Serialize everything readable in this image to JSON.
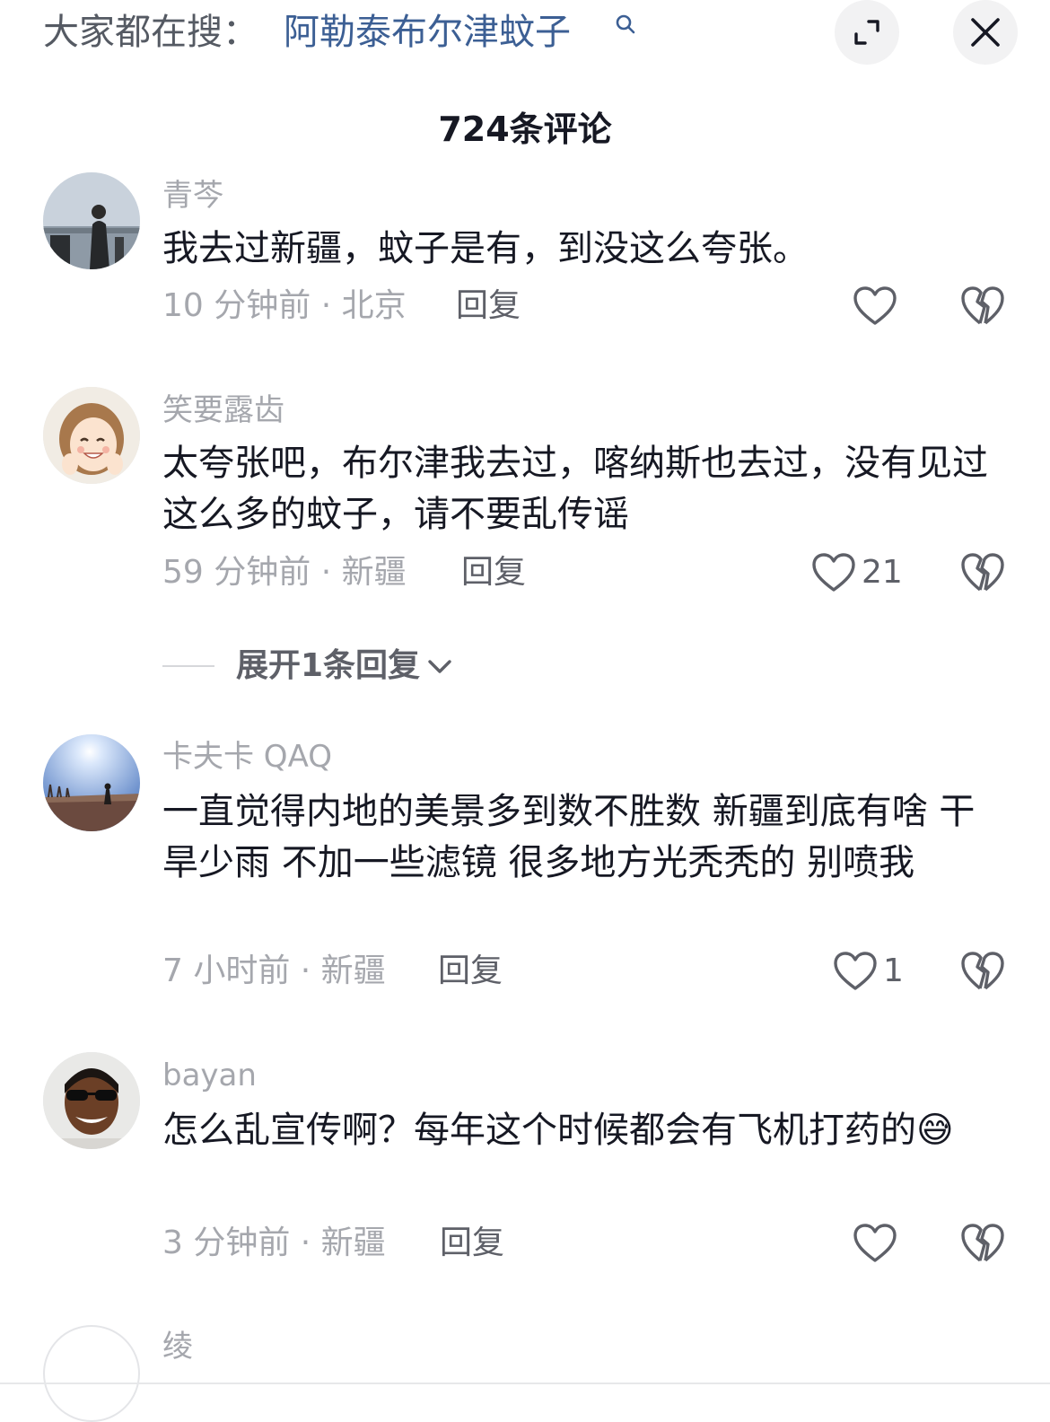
{
  "search": {
    "prefix": "大家都在搜：",
    "query": "阿勒泰布尔津蚊子"
  },
  "header": {
    "comment_count": "724条评论"
  },
  "colors": {
    "link": "#3c5f94",
    "secondary_text": "#a5a7ad",
    "primary_text": "#161823"
  },
  "comments": [
    {
      "username": "青芩",
      "content": "我去过新疆，蚊子是有，到没这么夸张。",
      "meta": "10 分钟前 · 北京",
      "reply": "回复",
      "likes": ""
    },
    {
      "username": "笑要露齿",
      "content": "太夸张吧，布尔津我去过，喀纳斯也去过，没有见过这么多的蚊子，请不要乱传谣",
      "meta": "59 分钟前 · 新疆",
      "reply": "回复",
      "likes": "21"
    },
    {
      "username": "卡夫卡 QAQ",
      "content": "一直觉得内地的美景多到数不胜数 新疆到底有啥 干旱少雨 不加一些滤镜 很多地方光秃秃的 别喷我",
      "meta": "7 小时前 · 新疆",
      "reply": "回复",
      "likes": "1"
    },
    {
      "username": "bayan",
      "content": "怎么乱宣传啊？每年这个时候都会有飞机打药的",
      "emoji": "😅",
      "meta": "3 分钟前 · 新疆",
      "reply": "回复",
      "likes": ""
    },
    {
      "username": "绫"
    }
  ],
  "expand_replies": {
    "label": "展开1条回复"
  }
}
